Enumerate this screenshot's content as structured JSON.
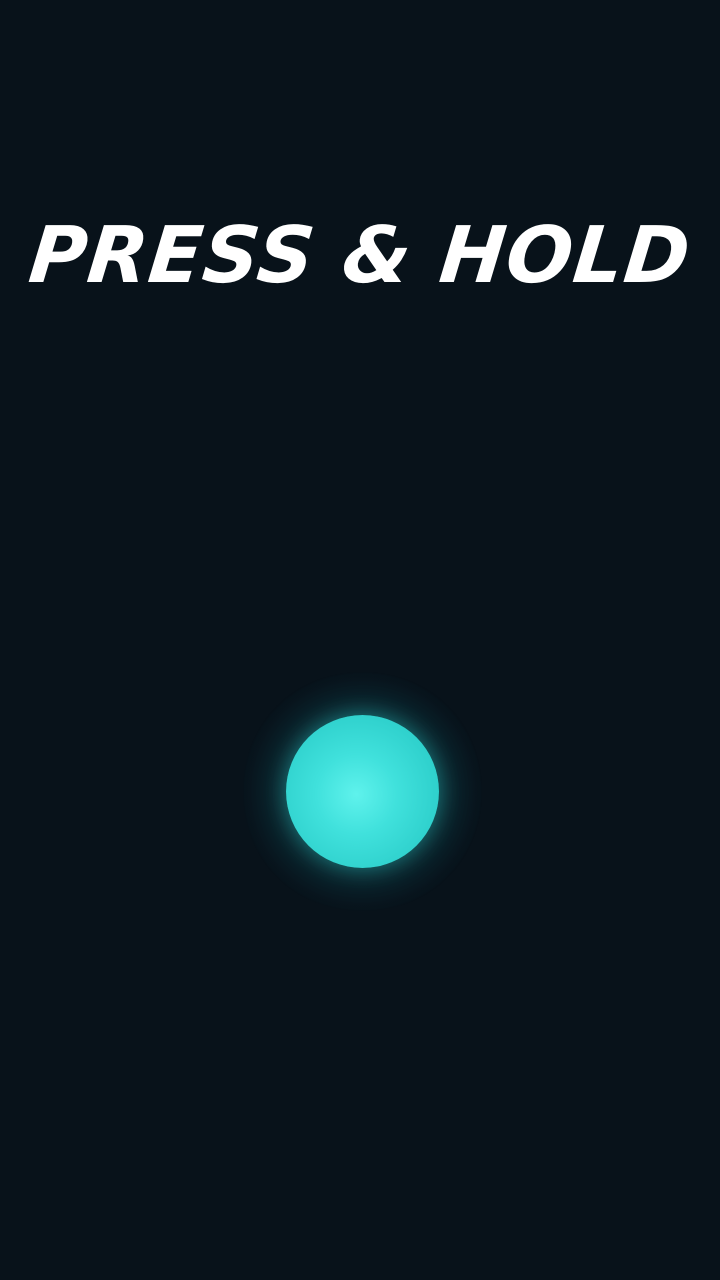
{
  "screen": {
    "title": "PRESS & HOLD"
  },
  "orb": {
    "icon": "glowing-orb-icon",
    "color": "#3fe0db",
    "glow_color": "#2dcfcb"
  },
  "colors": {
    "background": "#08121a",
    "title": "#ffffff"
  }
}
